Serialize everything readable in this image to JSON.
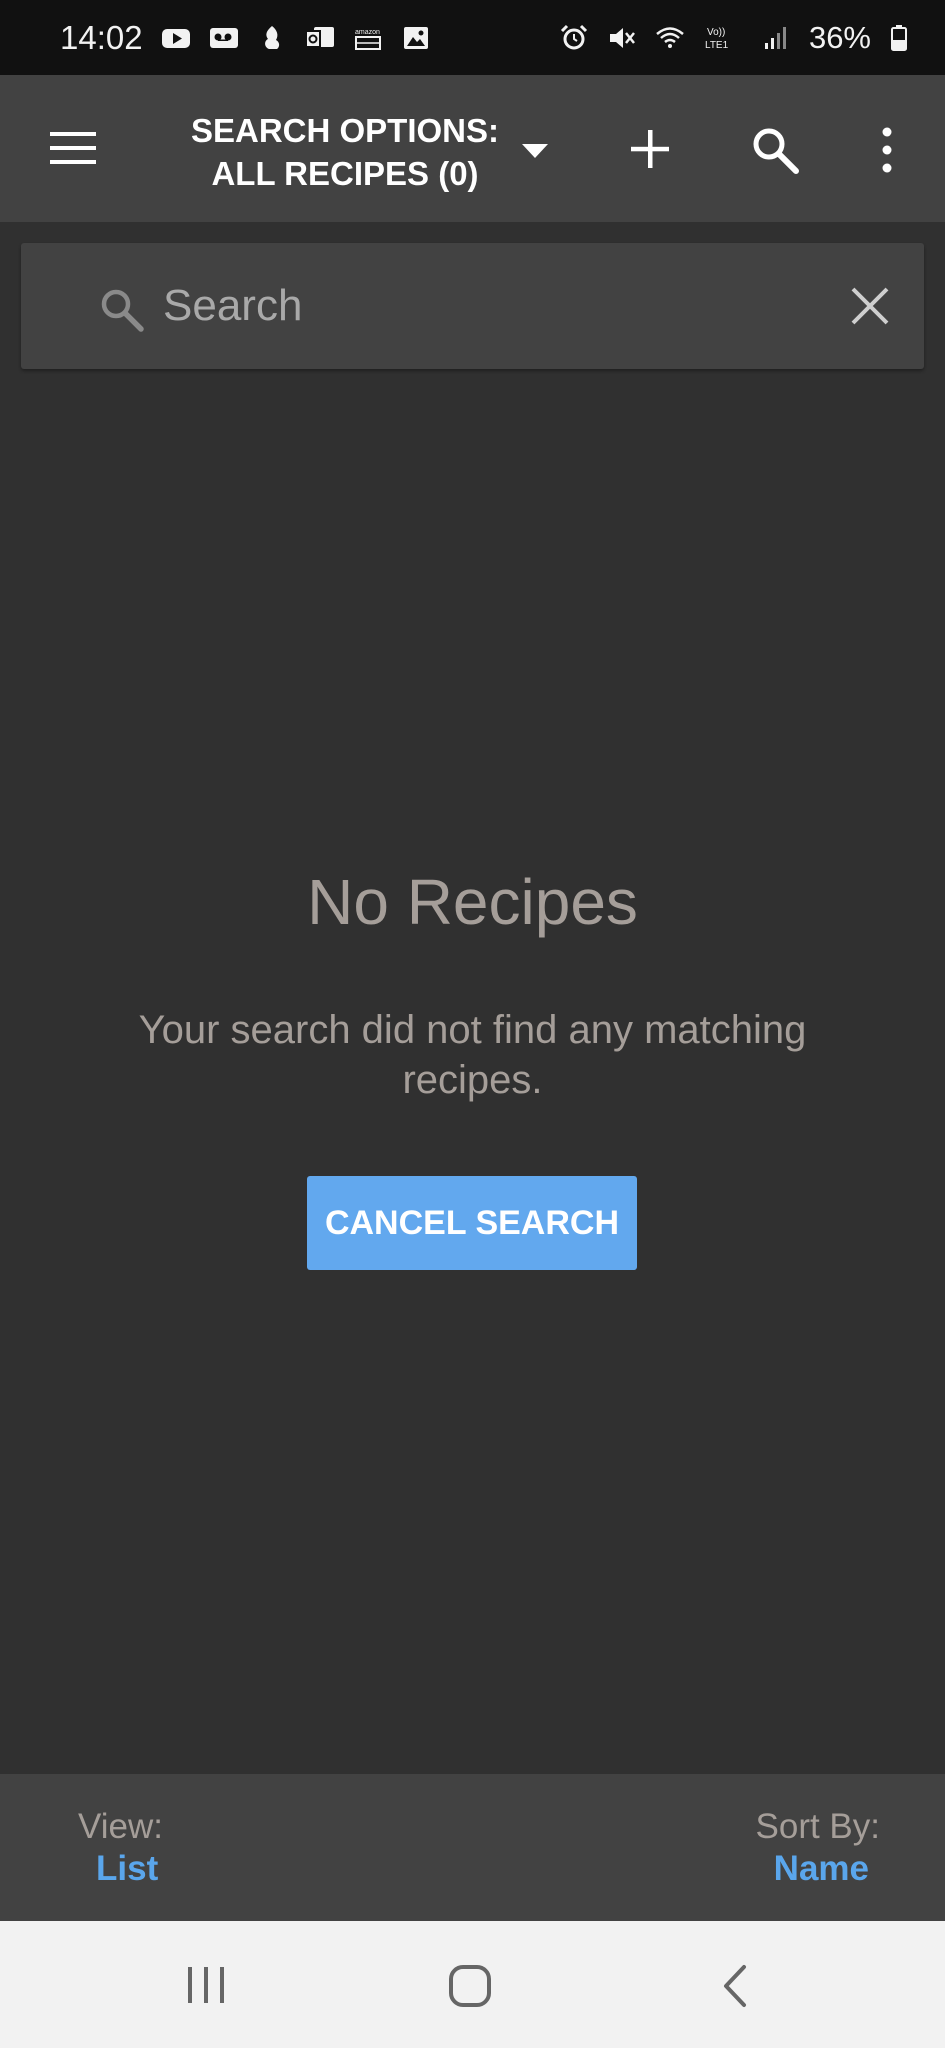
{
  "status_bar": {
    "time": "14:02",
    "battery": "36%",
    "left_icons": [
      "youtube-icon",
      "voicemail-icon",
      "app-icon",
      "outlook-icon",
      "amazon-icon",
      "gallery-icon"
    ],
    "right_icons": [
      "alarm-icon",
      "mute-icon",
      "wifi-icon",
      "volte-icon",
      "signal-icon",
      "battery-icon"
    ]
  },
  "app_bar": {
    "title_line1": "SEARCH OPTIONS:",
    "title_line2": "ALL RECIPES (0)",
    "icons": [
      "menu-icon",
      "dropdown-arrow-icon",
      "add-icon",
      "search-icon",
      "more-vert-icon"
    ]
  },
  "search": {
    "placeholder": "Search",
    "value": ""
  },
  "empty_state": {
    "title": "No Recipes",
    "message": "Your search did not find any matching recipes.",
    "button_label": "CANCEL SEARCH"
  },
  "bottom_bar": {
    "view_label": "View:",
    "view_value": "List",
    "sort_label": "Sort By:",
    "sort_value": "Name"
  },
  "colors": {
    "background": "#303030",
    "app_bar": "#424242",
    "accent": "#62a8ee",
    "muted_text": "#a59e99",
    "link_text": "#5aa6ec"
  }
}
